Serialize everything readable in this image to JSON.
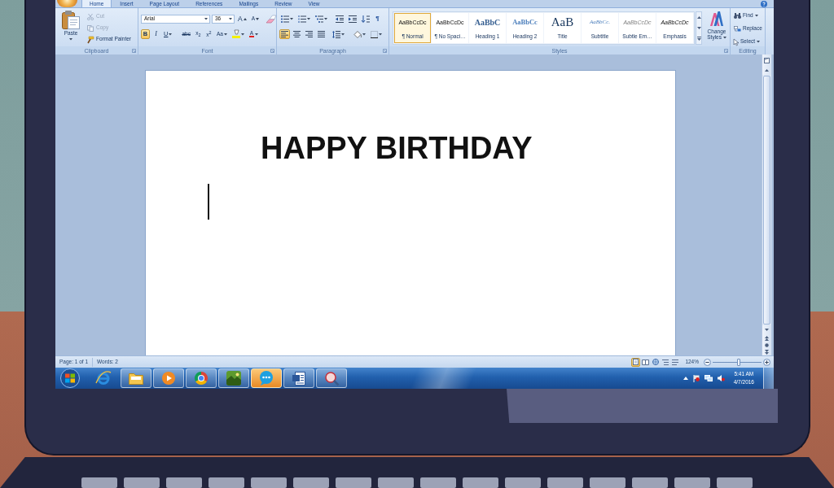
{
  "ribbon": {
    "tabs": [
      {
        "label": "Home",
        "selected": true
      },
      {
        "label": "Insert",
        "selected": false
      },
      {
        "label": "Page Layout",
        "selected": false
      },
      {
        "label": "References",
        "selected": false
      },
      {
        "label": "Mailings",
        "selected": false
      },
      {
        "label": "Review",
        "selected": false
      },
      {
        "label": "View",
        "selected": false
      }
    ],
    "clipboard": {
      "paste": "Paste",
      "commands": [
        {
          "kind": "cut",
          "label": "Cut",
          "disabled": true
        },
        {
          "kind": "copy",
          "label": "Copy",
          "disabled": true
        },
        {
          "kind": "format_painter",
          "label": "Format Painter",
          "disabled": false
        }
      ],
      "label": "Clipboard"
    },
    "font": {
      "font_name": "Arial",
      "font_size": "36",
      "grow_font": "A",
      "shrink_font": "A",
      "format_buttons": [
        {
          "kind": "bold",
          "label": "B",
          "on": true
        },
        {
          "kind": "italic",
          "label": "I",
          "on": false
        },
        {
          "kind": "underline",
          "label": "U",
          "on": false
        },
        {
          "kind": "strikethrough",
          "label": "abc",
          "on": false
        },
        {
          "kind": "subscript",
          "label": "x$_{2}$",
          "on": false
        },
        {
          "kind": "superscript",
          "label": "x$^{2}$",
          "on": false
        }
      ],
      "change_case": "Aa",
      "font_color": "A",
      "label": "Font"
    },
    "paragraph": {
      "alignment": [
        {
          "kind": "left",
          "selected": true
        },
        {
          "kind": "center",
          "selected": false
        },
        {
          "kind": "right",
          "selected": false
        },
        {
          "kind": "justify",
          "selected": false
        }
      ],
      "show_marks": "¶",
      "label": "Paragraph"
    },
    "styles": {
      "items": [
        {
          "kind": "normal",
          "preview": "AaBbCcDc",
          "name": "¶ Normal",
          "selected": true
        },
        {
          "kind": "no_spacing",
          "preview": "AaBbCcDc",
          "name": "¶ No Spaci…",
          "selected": false
        },
        {
          "kind": "heading_1",
          "preview": "AaBbC",
          "name": "Heading 1",
          "selected": false
        },
        {
          "kind": "heading_2",
          "preview": "AaBbCc",
          "name": "Heading 2",
          "selected": false
        },
        {
          "kind": "title",
          "preview": "AaB",
          "name": "Title",
          "selected": false
        },
        {
          "kind": "subtitle",
          "preview": "AaBbCc.",
          "name": "Subtitle",
          "selected": false
        },
        {
          "kind": "subtle_emphasis",
          "preview": "AaBbCcDc",
          "name": "Subtle Em…",
          "selected": false
        },
        {
          "kind": "emphasis",
          "preview": "AaBbCcDc",
          "name": "Emphasis",
          "selected": false
        }
      ],
      "change_styles": "Change Styles",
      "label": "Styles"
    },
    "editing": {
      "commands": [
        {
          "kind": "find",
          "label": "Find"
        },
        {
          "kind": "replace",
          "label": "Replace"
        },
        {
          "kind": "select",
          "label": "Select"
        }
      ],
      "label": "Editing"
    }
  },
  "document": {
    "heading": "HAPPY BIRTHDAY"
  },
  "status_bar": {
    "page": "Page: 1 of 1",
    "words": "Words: 2",
    "views": [
      {
        "kind": "print_layout",
        "selected": true
      },
      {
        "kind": "full_screen_reading",
        "selected": false
      },
      {
        "kind": "web_layout",
        "selected": false
      },
      {
        "kind": "outline",
        "selected": false
      },
      {
        "kind": "draft",
        "selected": false
      }
    ],
    "zoom": "124%",
    "zoom_slider": {
      "level": 0.53
    }
  },
  "taskbar": {
    "apps": [
      {
        "kind": "browser",
        "running": false,
        "flashing": false
      },
      {
        "kind": "folder",
        "running": true,
        "flashing": false
      },
      {
        "kind": "media_player",
        "running": true,
        "flashing": false
      },
      {
        "kind": "web_browser",
        "running": true,
        "flashing": false
      },
      {
        "kind": "game",
        "running": true,
        "flashing": false
      },
      {
        "kind": "messenger",
        "running": true,
        "flashing": true
      },
      {
        "kind": "word_processor",
        "running": true,
        "flashing": false
      },
      {
        "kind": "viewer",
        "running": true,
        "flashing": false
      }
    ],
    "clock": {
      "time": "5:41 AM",
      "date": "4/7/2016"
    }
  }
}
